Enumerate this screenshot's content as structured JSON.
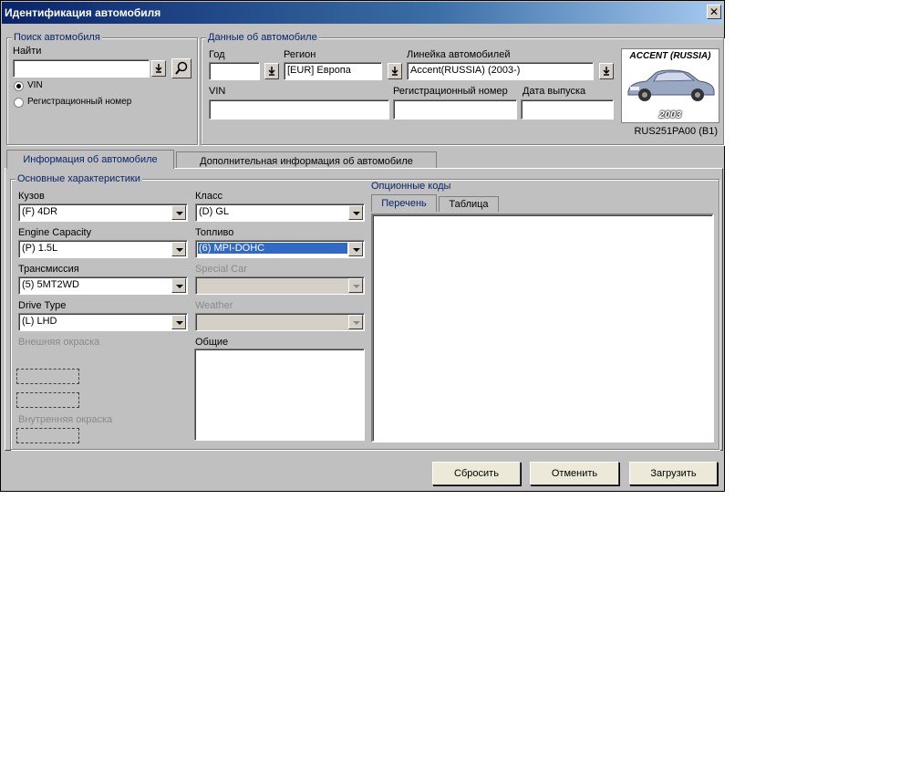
{
  "window": {
    "title": "Идентификация автомобиля",
    "close": "✕"
  },
  "search": {
    "title": "Поиск автомобиля",
    "find_label": "Найти",
    "find_value": "",
    "radio_vin": "VIN",
    "radio_reg": "Регистрационный номер"
  },
  "vehicle": {
    "title": "Данные об автомобиле",
    "year_label": "Год",
    "year_value": "",
    "region_label": "Регион",
    "region_value": "[EUR]  Европа",
    "line_label": "Линейка автомобилей",
    "line_value": "Accent(RUSSIA) (2003-)",
    "vin_label": "VIN",
    "vin_value": "",
    "reg_label": "Регистрационный номер",
    "reg_value": "",
    "date_label": "Дата выпуска",
    "date_value": "",
    "image_title": "ACCENT (RUSSIA)",
    "image_year": "2003",
    "model_code": "RUS251PA00 (B1)"
  },
  "tabs": {
    "info": "Информация об автомобиле",
    "extra": "Дополнительная информация об автомобиле"
  },
  "specs": {
    "title": "Основные характеристики",
    "body_label": "Кузов",
    "body_value": "(F) 4DR",
    "class_label": "Класс",
    "class_value": "(D) GL",
    "engine_label": "Engine Capacity",
    "engine_value": "(P) 1.5L",
    "fuel_label": "Топливо",
    "fuel_value": "(6) MPI-DOHC",
    "trans_label": "Трансмиссия",
    "trans_value": "(5) 5MT2WD",
    "special_label": "Special Car",
    "special_value": "",
    "drive_label": "Drive Type",
    "drive_value": "(L) LHD",
    "weather_label": "Weather",
    "weather_value": "",
    "ext_color_label": "Внешняя окраска",
    "general_label": "Общие",
    "int_color_label": "Внутренняя окраска"
  },
  "options": {
    "title": "Опционные коды",
    "tab_list": "Перечень",
    "tab_table": "Таблица"
  },
  "buttons": {
    "reset": "Сбросить",
    "cancel": "Отменить",
    "load": "Загрузить"
  }
}
